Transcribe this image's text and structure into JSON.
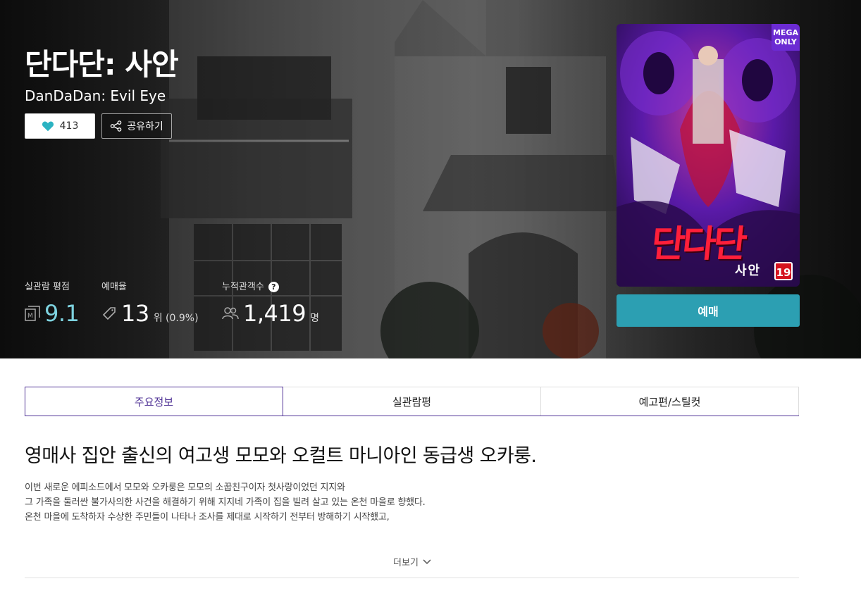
{
  "movie": {
    "title": "단다단: 사안",
    "subtitle": "DanDaDan: Evil Eye"
  },
  "actions": {
    "like_count": "413",
    "share_label": "공유하기",
    "book_label": "예매"
  },
  "stats": {
    "rating_label": "실관람 평점",
    "rating_value": "9.1",
    "reservation_label": "예매율",
    "reservation_rank": "13",
    "reservation_unit": "위 (0.9%)",
    "audience_label": "누적관객수",
    "audience_help": "?",
    "audience_value": "1,419",
    "audience_unit": "명"
  },
  "poster": {
    "badge_line1": "MEGA",
    "badge_line2": "ONLY",
    "art_title": "단다단",
    "art_sub": "사안",
    "age_rating": "19"
  },
  "tabs": [
    {
      "label": "주요정보",
      "active": true
    },
    {
      "label": "실관람평",
      "active": false
    },
    {
      "label": "예고편/스틸컷",
      "active": false
    }
  ],
  "synopsis": {
    "headline": "영매사 집안 출신의 여고생 모모와 오컬트 마니아인 동급생 오카룽.",
    "lines": [
      "이번 새로운 에피소드에서 모모와 오카룽은 모모의 소꿉친구이자 첫사랑이었던 지지와",
      "그 가족을 둘러싼 불가사의한 사건을 해결하기 위해 지지네 가족이 집을 빌려 살고 있는 온천 마을로 향했다.",
      "온천 마을에 도착하자 수상한 주민들이 나타나 조사를 제대로 시작하기 전부터 방해하기 시작했고,"
    ],
    "more_label": "더보기"
  },
  "colors": {
    "accent": "#2c9fb2",
    "tab_active": "#503396",
    "rating": "#7ed3e0",
    "like_heart": "#2cb3c2"
  }
}
